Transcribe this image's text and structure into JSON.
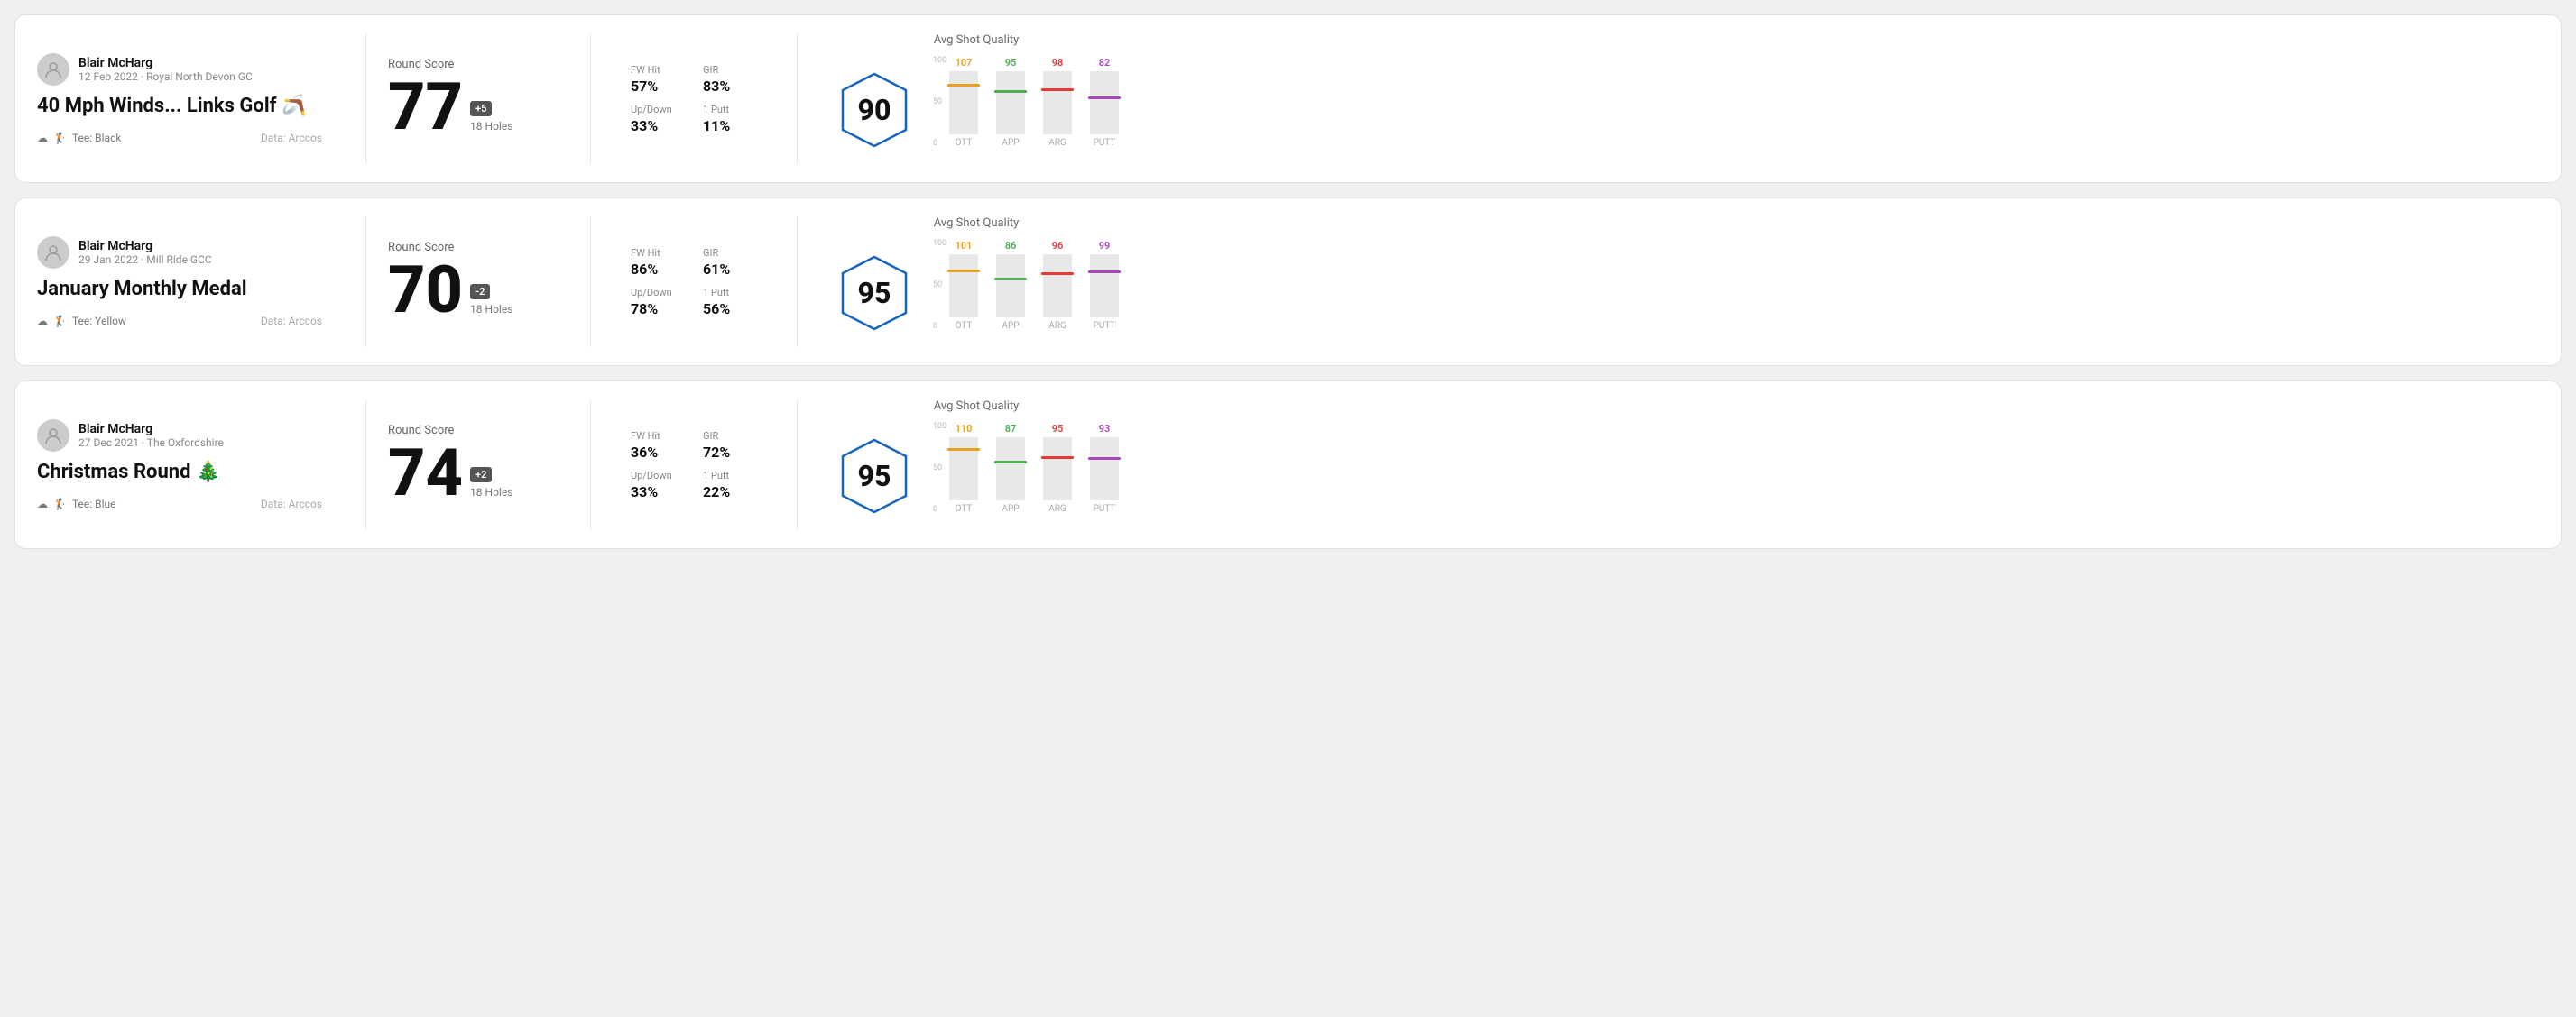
{
  "rounds": [
    {
      "id": "round-1",
      "user": {
        "name": "Blair McHarg",
        "date": "12 Feb 2022 · Royal North Devon GC"
      },
      "title": "40 Mph Winds... Links Golf 🪃",
      "tee": "Black",
      "data_source": "Data: Arccos",
      "score": {
        "label": "Round Score",
        "number": "77",
        "badge": "+5",
        "holes": "18 Holes"
      },
      "stats": {
        "fw_hit_label": "FW Hit",
        "fw_hit": "57%",
        "gir_label": "GIR",
        "gir": "83%",
        "updown_label": "Up/Down",
        "updown": "33%",
        "oneputt_label": "1 Putt",
        "oneputt": "11%"
      },
      "shot_quality": {
        "label": "Avg Shot Quality",
        "score": 90,
        "bars": [
          {
            "label": "OTT",
            "value": 107,
            "color": "#e8a020",
            "fill_pct": 75
          },
          {
            "label": "APP",
            "value": 95,
            "color": "#4caf50",
            "fill_pct": 65
          },
          {
            "label": "ARG",
            "value": 98,
            "color": "#e53935",
            "fill_pct": 68
          },
          {
            "label": "PUTT",
            "value": 82,
            "color": "#ab47bc",
            "fill_pct": 55
          }
        ]
      }
    },
    {
      "id": "round-2",
      "user": {
        "name": "Blair McHarg",
        "date": "29 Jan 2022 · Mill Ride GCC"
      },
      "title": "January Monthly Medal",
      "tee": "Yellow",
      "data_source": "Data: Arccos",
      "score": {
        "label": "Round Score",
        "number": "70",
        "badge": "-2",
        "holes": "18 Holes"
      },
      "stats": {
        "fw_hit_label": "FW Hit",
        "fw_hit": "86%",
        "gir_label": "GIR",
        "gir": "61%",
        "updown_label": "Up/Down",
        "updown": "78%",
        "oneputt_label": "1 Putt",
        "oneputt": "56%"
      },
      "shot_quality": {
        "label": "Avg Shot Quality",
        "score": 95,
        "bars": [
          {
            "label": "OTT",
            "value": 101,
            "color": "#e8a020",
            "fill_pct": 72
          },
          {
            "label": "APP",
            "value": 86,
            "color": "#4caf50",
            "fill_pct": 58
          },
          {
            "label": "ARG",
            "value": 96,
            "color": "#e53935",
            "fill_pct": 67
          },
          {
            "label": "PUTT",
            "value": 99,
            "color": "#ab47bc",
            "fill_pct": 70
          }
        ]
      }
    },
    {
      "id": "round-3",
      "user": {
        "name": "Blair McHarg",
        "date": "27 Dec 2021 · The Oxfordshire"
      },
      "title": "Christmas Round 🎄",
      "tee": "Blue",
      "data_source": "Data: Arccos",
      "score": {
        "label": "Round Score",
        "number": "74",
        "badge": "+2",
        "holes": "18 Holes"
      },
      "stats": {
        "fw_hit_label": "FW Hit",
        "fw_hit": "36%",
        "gir_label": "GIR",
        "gir": "72%",
        "updown_label": "Up/Down",
        "updown": "33%",
        "oneputt_label": "1 Putt",
        "oneputt": "22%"
      },
      "shot_quality": {
        "label": "Avg Shot Quality",
        "score": 95,
        "bars": [
          {
            "label": "OTT",
            "value": 110,
            "color": "#e8a020",
            "fill_pct": 78
          },
          {
            "label": "APP",
            "value": 87,
            "color": "#4caf50",
            "fill_pct": 59
          },
          {
            "label": "ARG",
            "value": 95,
            "color": "#e53935",
            "fill_pct": 66
          },
          {
            "label": "PUTT",
            "value": 93,
            "color": "#ab47bc",
            "fill_pct": 64
          }
        ]
      }
    }
  ],
  "y_axis": [
    "100",
    "50",
    "0"
  ],
  "tee_icon": "☁",
  "bag_icon": "🏌"
}
